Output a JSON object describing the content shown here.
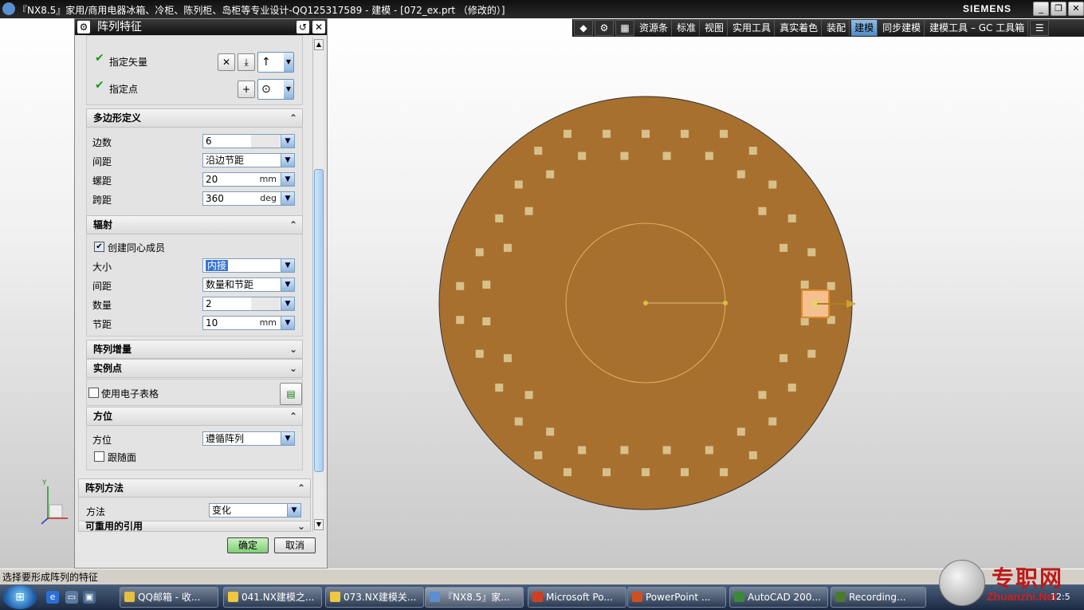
{
  "window": {
    "title": "『NX8.5』家用/商用电器冰箱、冷柜、陈列柜、岛柜等专业设计-QQ125317589 - 建模 - [072_ex.prt （修改的）]",
    "brand": "SIEMENS",
    "controls": {
      "minimize": "_",
      "restore": "❐",
      "close": "✕"
    }
  },
  "toolbar": {
    "tabs": [
      "资源条",
      "标准",
      "视图",
      "实用工具",
      "真实着色",
      "装配",
      "建模",
      "同步建模",
      "建模工具 – GC 工具箱"
    ],
    "active_tab": "建模",
    "icons": [
      "nx-logo-icon",
      "gear-icon",
      "grid-icon",
      "menu-icon"
    ]
  },
  "dialog": {
    "title": "阵列特征",
    "reset_icon": "↺",
    "close_icon": "✕",
    "direction": {
      "vector_label": "指定矢量",
      "point_label": "指定点"
    },
    "polygon": {
      "header": "多边形定义",
      "rows": [
        {
          "label": "边数",
          "value": "6",
          "unit": ""
        },
        {
          "label": "间距",
          "value": "沿边节距",
          "unit": ""
        },
        {
          "label": "螺距",
          "value": "20",
          "unit": "mm"
        },
        {
          "label": "跨距",
          "value": "360",
          "unit": "deg"
        }
      ]
    },
    "radiate": {
      "header": "辐射",
      "create_concentric_label": "创建同心成员",
      "rows": [
        {
          "label": "大小",
          "value": "内接",
          "unit": ""
        },
        {
          "label": "间距",
          "value": "数量和节距",
          "unit": ""
        },
        {
          "label": "数量",
          "value": "2",
          "unit": ""
        },
        {
          "label": "节距",
          "value": "10",
          "unit": "mm"
        }
      ]
    },
    "array_increment": "阵列增量",
    "instance_point": "实例点",
    "use_spreadsheet": "使用电子表格",
    "orientation": {
      "header": "方位",
      "label": "方位",
      "value": "遵循阵列",
      "follow_face": "跟随面"
    },
    "array_method": {
      "header": "阵列方法",
      "label": "方法",
      "value": "变化",
      "reusable_ref": "可重用的引用"
    },
    "ok": "确定",
    "cancel": "取消"
  },
  "status": "选择要形成阵列的特征",
  "taskbar": {
    "items": [
      "QQ邮箱 - 收...",
      "041.NX建模之...",
      "073.NX建模关...",
      "『NX8.5』家...",
      "Microsoft Po...",
      "PowerPoint ...",
      "AutoCAD 200...",
      "Recording..."
    ],
    "clock": "12:5"
  },
  "watermark": {
    "cn": "专职网",
    "en": "Zhuanzhi.Net"
  },
  "axes": {
    "y": "Y",
    "x": "X"
  },
  "colors": {
    "disk": "#a8702f",
    "slot": "#d8c08a",
    "accent": "#3875d7"
  }
}
